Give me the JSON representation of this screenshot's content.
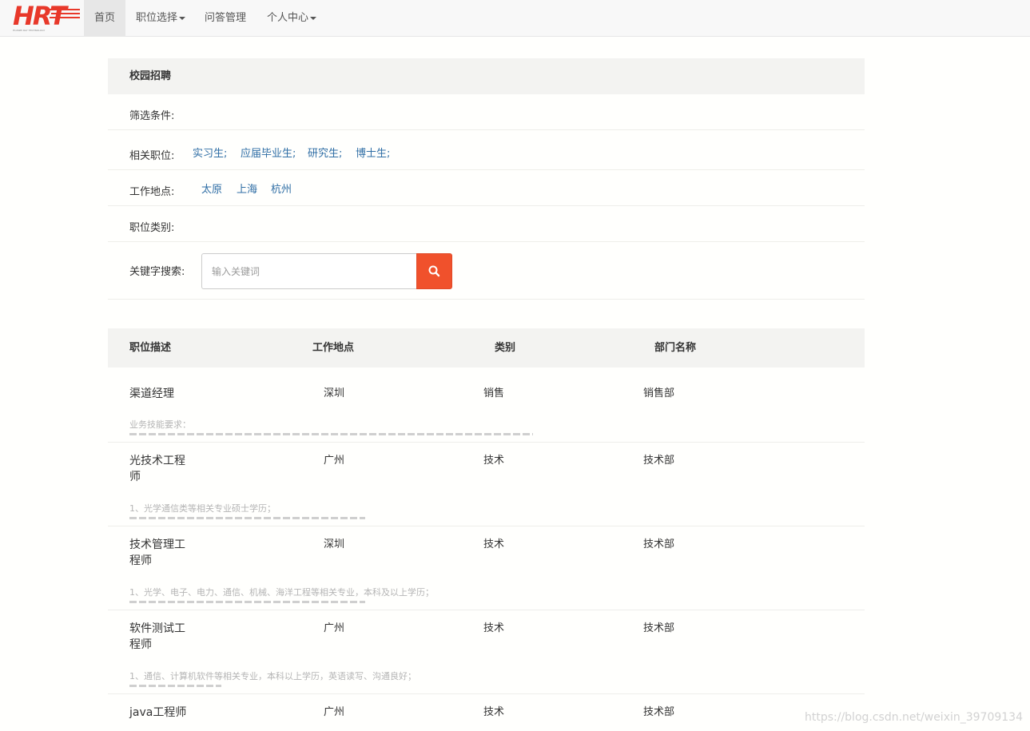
{
  "navbar": {
    "logo_text": "HRT",
    "logo_tagline": "HUAWEI RAY TECHNOLOGY",
    "items": [
      {
        "label": "首页",
        "active": true,
        "dropdown": false
      },
      {
        "label": "职位选择",
        "active": false,
        "dropdown": true
      },
      {
        "label": "问答管理",
        "active": false,
        "dropdown": false
      },
      {
        "label": "个人中心",
        "active": false,
        "dropdown": true
      }
    ]
  },
  "filter": {
    "title": "校园招聘",
    "conditions_label": "筛选条件:",
    "position_label": "相关职位:",
    "position_options": [
      "实习生;",
      "应届毕业生;",
      "研究生;",
      "博士生;"
    ],
    "location_label": "工作地点:",
    "location_options": [
      "太原",
      "上海",
      "杭州"
    ],
    "category_label": "职位类别:",
    "keyword_label": "关键字搜索:",
    "keyword_placeholder": "输入关键词",
    "search_icon": "search-icon",
    "accent_color": "#f0512c",
    "link_color": "#2f6ea5"
  },
  "table": {
    "headers": {
      "description": "职位描述",
      "location": "工作地点",
      "category": "类别",
      "department": "部门名称"
    },
    "jobs": [
      {
        "title": "渠道经理",
        "location": "深圳",
        "category": "销售",
        "department": "销售部",
        "desc": "业务技能要求："
      },
      {
        "title": "光技术工程师",
        "location": "广州",
        "category": "技术",
        "department": "技术部",
        "desc": "1、光学通信类等相关专业硕士学历；"
      },
      {
        "title": "技术管理工程师",
        "location": "深圳",
        "category": "技术",
        "department": "技术部",
        "desc": "1、光学、电子、电力、通信、机械、海洋工程等相关专业，本科及以上学历；"
      },
      {
        "title": "软件测试工程师",
        "location": "广州",
        "category": "技术",
        "department": "技术部",
        "desc": "1、通信、计算机软件等相关专业，本科以上学历，英语读写、沟通良好；"
      },
      {
        "title": "java工程师",
        "location": "广州",
        "category": "技术",
        "department": "技术部",
        "desc": ""
      }
    ]
  },
  "watermark": "https://blog.csdn.net/weixin_39709134"
}
